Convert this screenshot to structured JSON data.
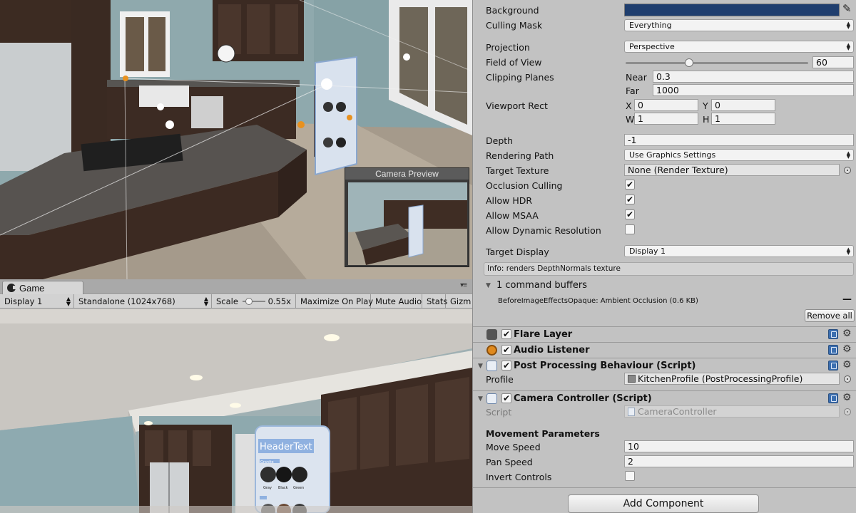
{
  "scene": {
    "camera_preview_title": "Camera Preview"
  },
  "game": {
    "tab_label": "Game",
    "display": "Display 1",
    "resolution": "Standalone (1024x768)",
    "scale_label": "Scale",
    "scale_value": "0.55x",
    "scale_fraction": 0.2,
    "maximize_on_play": "Maximize On Play",
    "mute_audio": "Mute Audio",
    "stats": "Stats",
    "gizmos": "Gizm",
    "ui_panel_header": "HeaderText",
    "ui_panel_section": "Granite",
    "ui_panel_swatches": [
      "Gray",
      "Black",
      "Green"
    ]
  },
  "inspector": {
    "camera": {
      "background_label": "Background",
      "background_color": "#1f3e6e",
      "culling_mask_label": "Culling Mask",
      "culling_mask": "Everything",
      "projection_label": "Projection",
      "projection": "Perspective",
      "fov_label": "Field of View",
      "fov_value": "60",
      "fov_fraction": 0.34,
      "clipping_label": "Clipping Planes",
      "near_label": "Near",
      "near_value": "0.3",
      "far_label": "Far",
      "far_value": "1000",
      "viewport_label": "Viewport Rect",
      "x_label": "X",
      "x_value": "0",
      "y_label": "Y",
      "y_value": "0",
      "w_label": "W",
      "w_value": "1",
      "h_label": "H",
      "h_value": "1",
      "depth_label": "Depth",
      "depth_value": "-1",
      "rendering_path_label": "Rendering Path",
      "rendering_path": "Use Graphics Settings",
      "target_texture_label": "Target Texture",
      "target_texture": "None (Render Texture)",
      "occlusion_label": "Occlusion Culling",
      "occlusion_checked": "✔",
      "hdr_label": "Allow HDR",
      "hdr_checked": "✔",
      "msaa_label": "Allow MSAA",
      "msaa_checked": "✔",
      "dynres_label": "Allow Dynamic Resolution",
      "dynres_checked": "",
      "target_display_label": "Target Display",
      "target_display": "Display 1",
      "info_text": "Info: renders DepthNormals texture",
      "command_buffers": "1 command buffers",
      "command_buffer_item": "BeforeImageEffectsOpaque: Ambient Occlusion (0.6 KB)",
      "remove_all": "Remove all"
    },
    "components": {
      "flare_layer": "Flare Layer",
      "audio_listener": "Audio Listener",
      "post_processing": "Post Processing Behaviour (Script)",
      "profile_label": "Profile",
      "profile_value": "KitchenProfile (PostProcessingProfile)",
      "camera_controller": "Camera Controller (Script)",
      "script_label": "Script",
      "script_value": "CameraController"
    },
    "movement": {
      "header": "Movement Parameters",
      "move_speed_label": "Move Speed",
      "move_speed": "10",
      "pan_speed_label": "Pan Speed",
      "pan_speed": "2",
      "invert_label": "Invert Controls",
      "invert_checked": ""
    },
    "add_component": "Add Component"
  }
}
